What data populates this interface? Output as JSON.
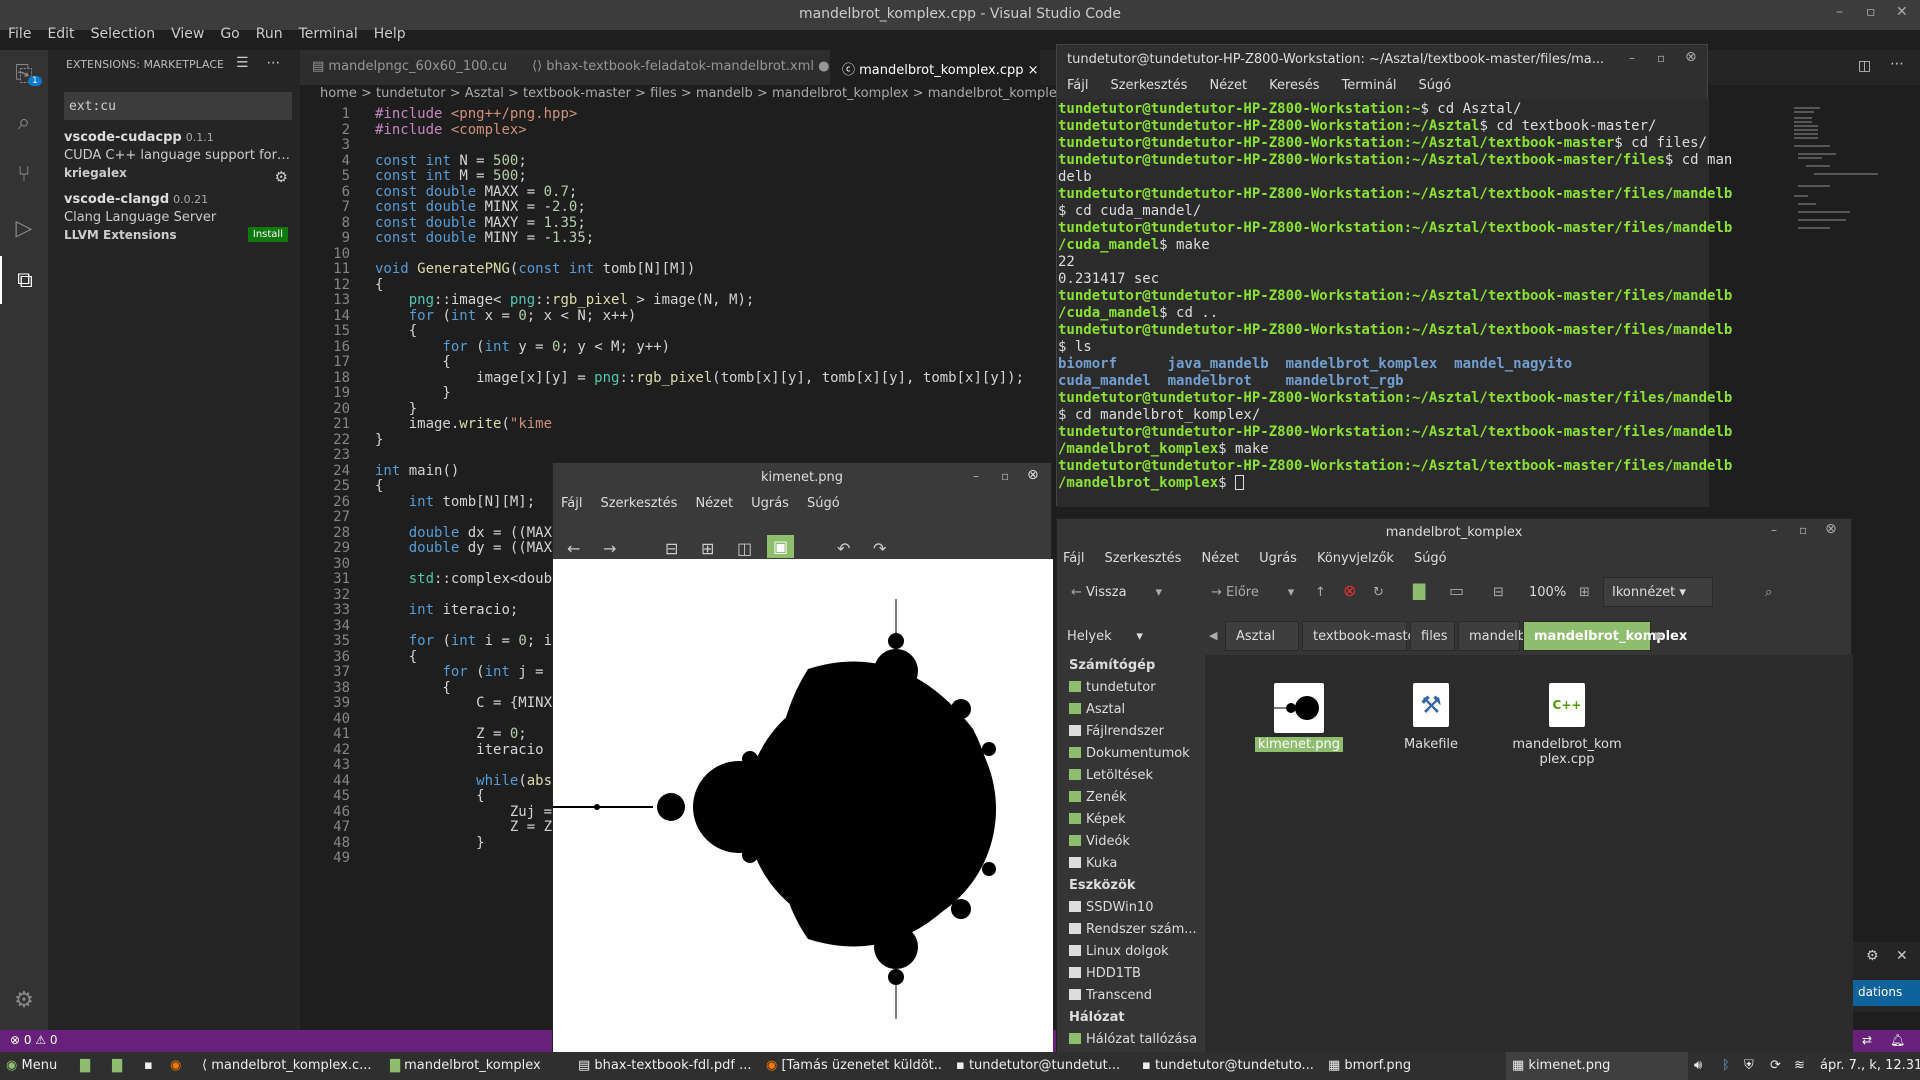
{
  "vscode": {
    "window_title": "mandelbrot_komplex.cpp - Visual Studio Code",
    "menu": [
      "File",
      "Edit",
      "Selection",
      "View",
      "Go",
      "Run",
      "Terminal",
      "Help"
    ],
    "activity_badge": "1",
    "extensions": {
      "header": "EXTENSIONS: MARKETPLACE",
      "search_value": "ext:cu",
      "items": [
        {
          "name": "vscode-cudacpp",
          "version": "0.1.1",
          "desc": "CUDA C++ language support for Visu...",
          "publisher": "kriegalex"
        },
        {
          "name": "vscode-clangd",
          "version": "0.0.21",
          "desc": "Clang Language Server",
          "publisher": "LLVM Extensions",
          "action": "Install"
        }
      ]
    },
    "tabs": [
      {
        "label": "mandelpngc_60x60_100.cu"
      },
      {
        "label": "bhax-textbook-feladatok-mandelbrot.xml",
        "modified": "●"
      },
      {
        "label": "mandelbrot_komplex.cpp",
        "close": "×"
      }
    ],
    "breadcrumb": "home > tundetutor > Asztal > textbook-master > files > mandelb > mandelbrot_komplex > mandelbrot_komplex.cpp",
    "status_left": "⊗ 0 ⚠ 0",
    "notification_text": "dations"
  },
  "code": [
    {
      "n": "1",
      "t": "#include <png++/png.hpp>",
      "c": "pp"
    },
    {
      "n": "2",
      "t": "#include <complex>",
      "c": "pp"
    },
    {
      "n": "3",
      "t": ""
    },
    {
      "n": "4",
      "t": "const int N = 500;"
    },
    {
      "n": "5",
      "t": "const int M = 500;"
    },
    {
      "n": "6",
      "t": "const double MAXX = 0.7;"
    },
    {
      "n": "7",
      "t": "const double MINX = -2.0;"
    },
    {
      "n": "8",
      "t": "const double MAXY = 1.35;"
    },
    {
      "n": "9",
      "t": "const double MINY = -1.35;"
    },
    {
      "n": "10",
      "t": ""
    },
    {
      "n": "11",
      "t": "void GeneratePNG(const int tomb[N][M])"
    },
    {
      "n": "12",
      "t": "{"
    },
    {
      "n": "13",
      "t": "    png::image< png::rgb_pixel > image(N, M);"
    },
    {
      "n": "14",
      "t": "    for (int x = 0; x < N; x++)"
    },
    {
      "n": "15",
      "t": "    {"
    },
    {
      "n": "16",
      "t": "        for (int y = 0; y < M; y++)"
    },
    {
      "n": "17",
      "t": "        {"
    },
    {
      "n": "18",
      "t": "            image[x][y] = png::rgb_pixel(tomb[x][y], tomb[x][y], tomb[x][y]);"
    },
    {
      "n": "19",
      "t": "        }"
    },
    {
      "n": "20",
      "t": "    }"
    },
    {
      "n": "21",
      "t": "    image.write(\"kime"
    },
    {
      "n": "22",
      "t": "}"
    },
    {
      "n": "23",
      "t": ""
    },
    {
      "n": "24",
      "t": "int main()"
    },
    {
      "n": "25",
      "t": "{"
    },
    {
      "n": "26",
      "t": "    int tomb[N][M];"
    },
    {
      "n": "27",
      "t": ""
    },
    {
      "n": "28",
      "t": "    double dx = ((MAX"
    },
    {
      "n": "29",
      "t": "    double dy = ((MAX"
    },
    {
      "n": "30",
      "t": ""
    },
    {
      "n": "31",
      "t": "    std::complex<doub"
    },
    {
      "n": "32",
      "t": ""
    },
    {
      "n": "33",
      "t": "    int iteracio;"
    },
    {
      "n": "34",
      "t": ""
    },
    {
      "n": "35",
      "t": "    for (int i = 0; i"
    },
    {
      "n": "36",
      "t": "    {"
    },
    {
      "n": "37",
      "t": "        for (int j ="
    },
    {
      "n": "38",
      "t": "        {"
    },
    {
      "n": "39",
      "t": "            C = {MINX"
    },
    {
      "n": "40",
      "t": ""
    },
    {
      "n": "41",
      "t": "            Z = 0;"
    },
    {
      "n": "42",
      "t": "            iteracio"
    },
    {
      "n": "43",
      "t": ""
    },
    {
      "n": "44",
      "t": "            while(abs"
    },
    {
      "n": "45",
      "t": "            {"
    },
    {
      "n": "46",
      "t": "                Zuj ="
    },
    {
      "n": "47",
      "t": "                Z = Z"
    },
    {
      "n": "48",
      "t": "            }"
    },
    {
      "n": "49",
      "t": ""
    }
  ],
  "terminal": {
    "title": "tundetutor@tundetutor-HP-Z800-Workstation: ~/Asztal/textbook-master/files/ma...",
    "menu": [
      "Fájl",
      "Szerkesztés",
      "Nézet",
      "Keresés",
      "Terminál",
      "Súgó"
    ],
    "lines": [
      {
        "p": "tundetutor@tundetutor-HP-Z800-Workstation:~",
        "t": "$ cd Asztal/"
      },
      {
        "p": "tundetutor@tundetutor-HP-Z800-Workstation:~/Asztal",
        "t": "$ cd textbook-master/"
      },
      {
        "p": "tundetutor@tundetutor-HP-Z800-Workstation:~/Asztal/textbook-master",
        "t": "$ cd files/"
      },
      {
        "p": "tundetutor@tundetutor-HP-Z800-Workstation:~/Asztal/textbook-master/files",
        "t": "$ cd man"
      },
      {
        "t": "delb"
      },
      {
        "p": "tundetutor@tundetutor-HP-Z800-Workstation:~/Asztal/textbook-master/files/mandelb",
        "t": ""
      },
      {
        "t": "$ cd cuda_mandel/"
      },
      {
        "p": "tundetutor@tundetutor-HP-Z800-Workstation:~/Asztal/textbook-master/files/mandelb",
        "t": ""
      },
      {
        "p": "/cuda_mandel",
        "t": "$ make"
      },
      {
        "t": "22"
      },
      {
        "t": "0.231417 sec"
      },
      {
        "p": "tundetutor@tundetutor-HP-Z800-Workstation:~/Asztal/textbook-master/files/mandelb",
        "t": ""
      },
      {
        "p": "/cuda_mandel",
        "t": "$ cd .."
      },
      {
        "p": "tundetutor@tundetutor-HP-Z800-Workstation:~/Asztal/textbook-master/files/mandelb",
        "t": ""
      },
      {
        "t": "$ ls"
      },
      {
        "d": "biomorf      java_mandelb  mandelbrot_komplex  mandel_nagyito"
      },
      {
        "d": "cuda_mandel  mandelbrot    mandelbrot_rgb"
      },
      {
        "p": "tundetutor@tundetutor-HP-Z800-Workstation:~/Asztal/textbook-master/files/mandelb",
        "t": ""
      },
      {
        "t": "$ cd mandelbrot_komplex/"
      },
      {
        "p": "tundetutor@tundetutor-HP-Z800-Workstation:~/Asztal/textbook-master/files/mandelb",
        "t": ""
      },
      {
        "p": "/mandelbrot_komplex",
        "t": "$ make"
      },
      {
        "p": "tundetutor@tundetutor-HP-Z800-Workstation:~/Asztal/textbook-master/files/mandelb",
        "t": ""
      },
      {
        "p": "/mandelbrot_komplex",
        "t": "$ "
      }
    ]
  },
  "image_viewer": {
    "title": "kimenet.png",
    "menu": [
      "Fájl",
      "Szerkesztés",
      "Nézet",
      "Ugrás",
      "Súgó"
    ]
  },
  "file_manager": {
    "title": "mandelbrot_komplex",
    "menu": [
      "Fájl",
      "Szerkesztés",
      "Nézet",
      "Ugrás",
      "Könyvjelzők",
      "Súgó"
    ],
    "back_label": "Vissza",
    "forward_label": "Előre",
    "zoom": "100%",
    "view_mode": "Ikonnézet",
    "places_label": "Helyek",
    "path": [
      "Asztal",
      "textbook-master",
      "files",
      "mandelb",
      "mandelbrot_komplex"
    ],
    "sidebar": [
      {
        "h": "Számítógép"
      },
      {
        "i": "tundetutor"
      },
      {
        "i": "Asztal"
      },
      {
        "i": "Fájlrendszer",
        "dev": true
      },
      {
        "i": "Dokumentumok"
      },
      {
        "i": "Letöltések"
      },
      {
        "i": "Zenék"
      },
      {
        "i": "Képek"
      },
      {
        "i": "Videók"
      },
      {
        "i": "Kuka",
        "dev": true
      },
      {
        "h": "Eszközök"
      },
      {
        "i": "SSDWin10",
        "dev": true
      },
      {
        "i": "Rendszer szám...",
        "dev": true
      },
      {
        "i": "Linux dolgok",
        "dev": true
      },
      {
        "i": "HDD1TB",
        "dev": true
      },
      {
        "i": "Transcend",
        "dev": true
      },
      {
        "h": "Hálózat"
      },
      {
        "i": "Hálózat tallózása"
      }
    ],
    "files": [
      {
        "name": "kimenet.png",
        "kind": "image"
      },
      {
        "name": "Makefile",
        "kind": "make"
      },
      {
        "name": "mandelbrot_komplex.cpp",
        "kind": "cpp",
        "badge": "C++"
      }
    ]
  },
  "taskbar": {
    "menu": "Menu",
    "items": [
      "mandelbrot_komplex.c...",
      "mandelbrot_komplex",
      "bhax-textbook-fdl.pdf ...",
      "[Tamás üzenetet küldöt...",
      "tundetutor@tundetut...",
      "tundetutor@tundetuto...",
      "bmorf.png",
      "kimenet.png"
    ],
    "clock": "ápr. 7., k, 12.31"
  }
}
